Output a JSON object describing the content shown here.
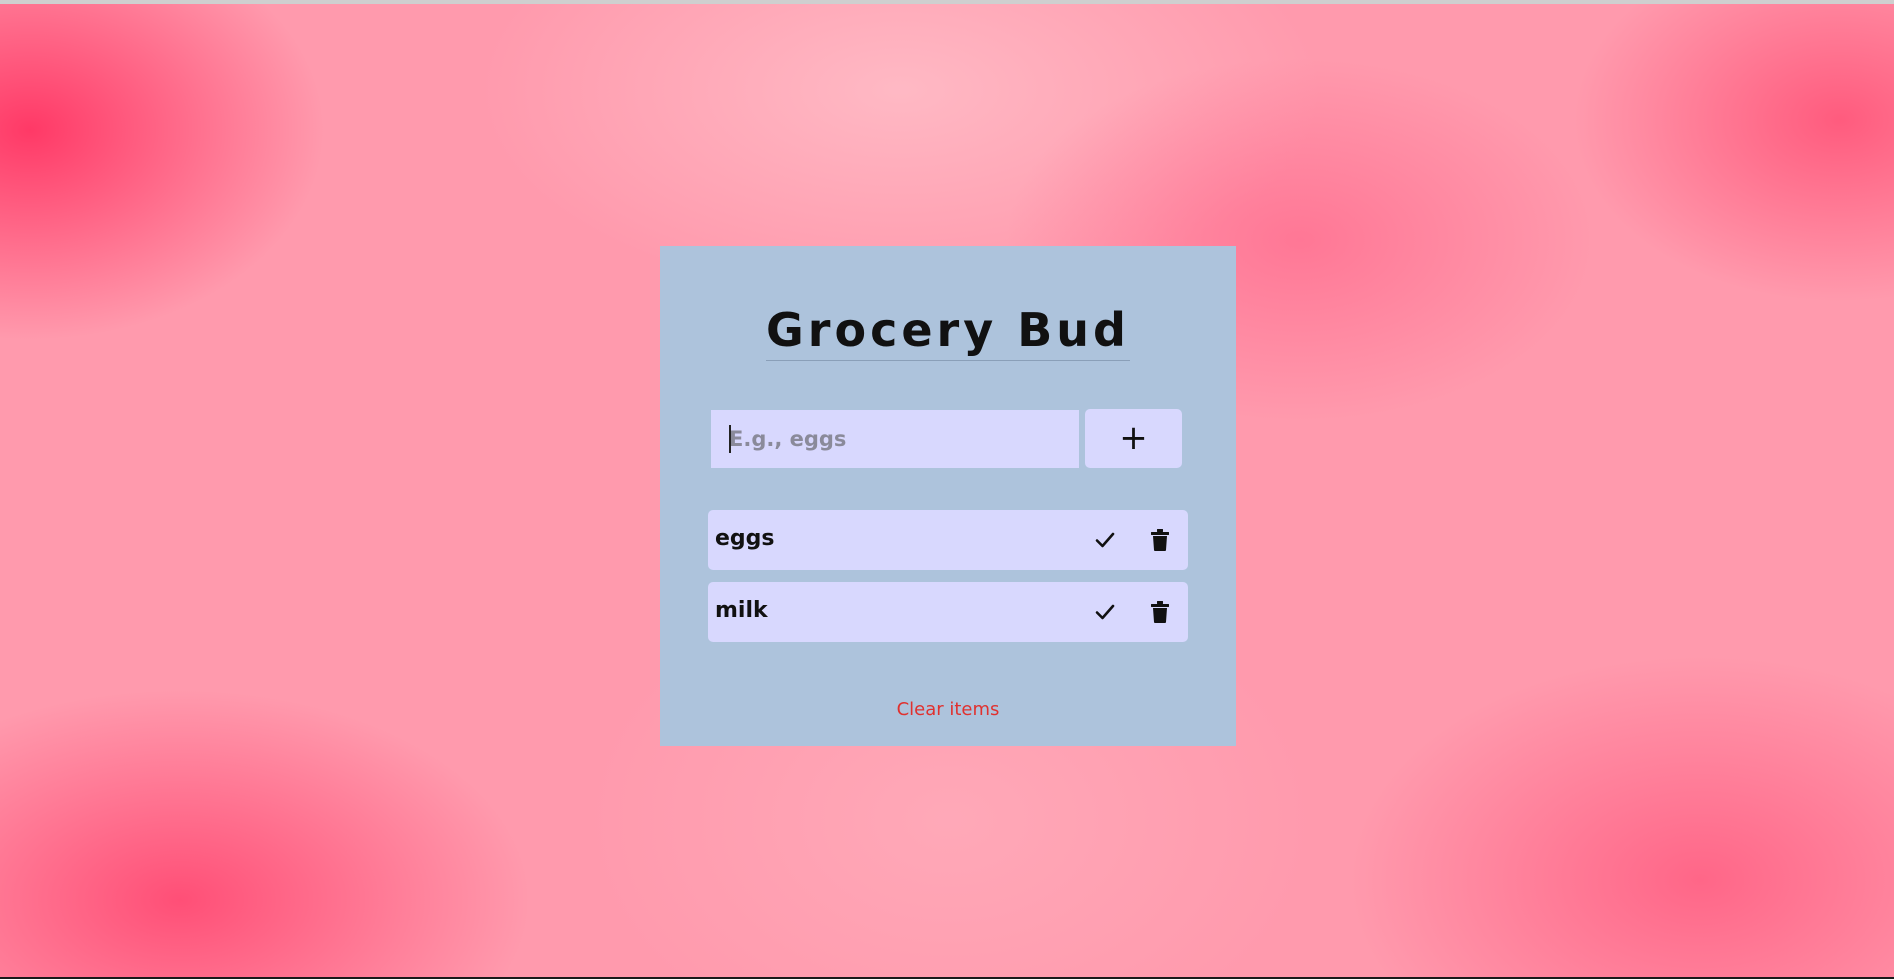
{
  "app": {
    "title": "Grocery Bud"
  },
  "form": {
    "input_placeholder": "E.g., eggs",
    "input_value": "",
    "add_button_label": "+"
  },
  "items": [
    {
      "name": "eggs",
      "check_icon": "check-icon",
      "delete_icon": "trash-icon"
    },
    {
      "name": "milk",
      "check_icon": "check-icon",
      "delete_icon": "trash-icon"
    }
  ],
  "footer": {
    "clear_label": "Clear items"
  },
  "colors": {
    "card_background": "#adc3dc",
    "input_background": "#d8d8fe",
    "clear_text": "#e0312f",
    "page_background": "#ff9aad"
  }
}
